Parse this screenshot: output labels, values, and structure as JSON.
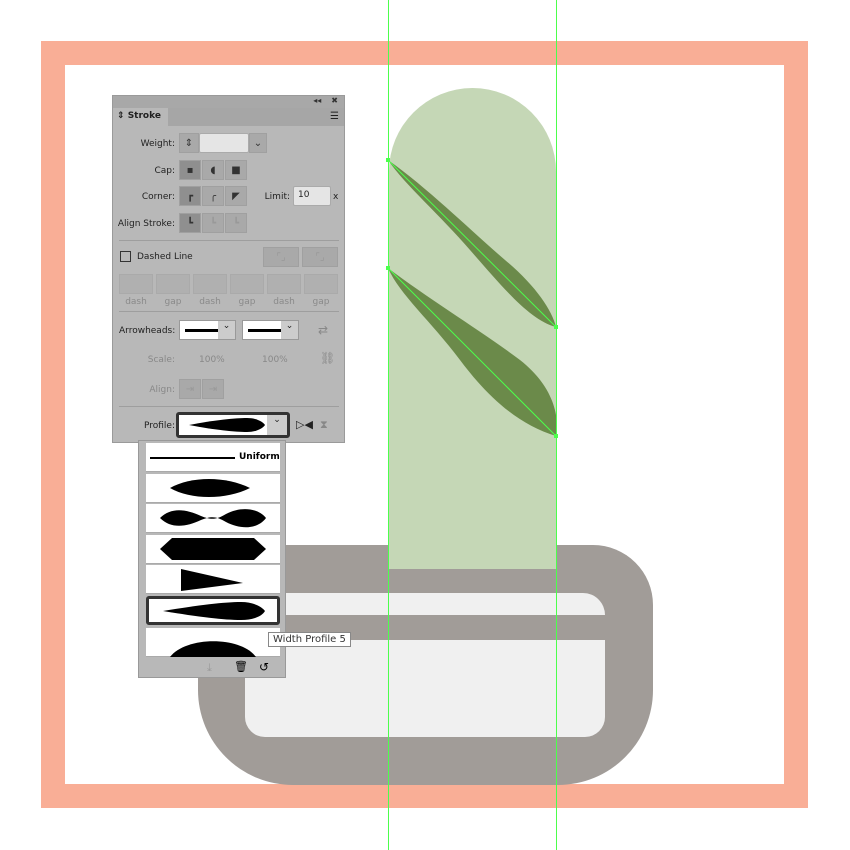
{
  "colors": {
    "frame": "#F9AE96",
    "pill": "#C5D7B6",
    "leaf": "#6B8A4A",
    "pot": "#A19C98",
    "pot_inner": "#F0F0F0",
    "guide": "#4CFF4C"
  },
  "panel": {
    "collapse_icon": "double-chevron-left-icon",
    "close_icon": "close-icon",
    "title": "Stroke",
    "weight_label": "Weight:",
    "weight_value": "",
    "cap_label": "Cap:",
    "corner_label": "Corner:",
    "limit_label": "Limit:",
    "limit_value": "10",
    "limit_unit": "x",
    "align_label": "Align Stroke:",
    "dashed_label": "Dashed Line",
    "dashed_checked": false,
    "dash_fields": [
      "dash",
      "gap",
      "dash",
      "gap",
      "dash",
      "gap"
    ],
    "arrowheads_label": "Arrowheads:",
    "scale_label": "Scale:",
    "scale_values": [
      "100%",
      "100%"
    ],
    "align2_label": "Align:",
    "profile_label": "Profile:"
  },
  "profiles": {
    "items": [
      {
        "label": "Uniform"
      },
      {
        "label": ""
      },
      {
        "label": ""
      },
      {
        "label": ""
      },
      {
        "label": ""
      },
      {
        "label": "",
        "selected": true
      },
      {
        "label": ""
      }
    ],
    "tooltip": "Width Profile 5"
  }
}
